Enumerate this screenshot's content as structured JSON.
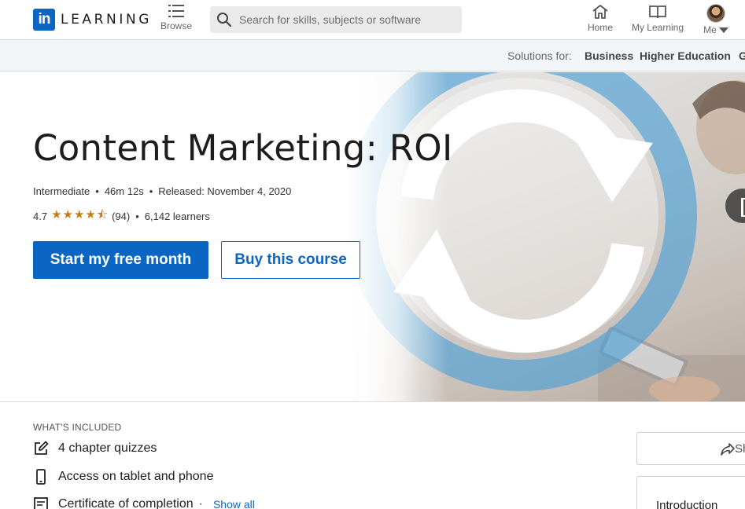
{
  "brand": {
    "logo_mark": "in",
    "wordmark": "LEARNING",
    "color": "#0a66c2"
  },
  "topnav": {
    "browse_label": "Browse",
    "search_placeholder": "Search for skills, subjects or software",
    "home_label": "Home",
    "mylearning_label": "My Learning",
    "me_label": "Me"
  },
  "solutions": {
    "label": "Solutions for:",
    "items": [
      "Business",
      "Higher Education",
      "G"
    ]
  },
  "course": {
    "title": "Content Marketing: ROI",
    "level": "Intermediate",
    "duration": "46m 12s",
    "released": "Released: November 4, 2020",
    "rating": "4.7",
    "rating_value": 4.7,
    "stars": "★★★★⯪",
    "review_count": "(94)",
    "learners": "6,142 learners"
  },
  "actions": {
    "primary": "Start my free month",
    "secondary": "Buy this course"
  },
  "included": {
    "title": "WHAT'S INCLUDED",
    "items": [
      "4 chapter quizzes",
      "Access on tablet and phone",
      "Certificate of completion"
    ],
    "show_all": "Show all"
  },
  "sidebar": {
    "share_label": "Sh",
    "toc_first": "Introduction"
  },
  "icons": [
    "search-icon",
    "browse-icon",
    "home-icon",
    "book-icon",
    "avatar",
    "edit-icon",
    "phone-icon",
    "certificate-icon",
    "share-icon",
    "play-icon"
  ],
  "colors": {
    "accent": "#0a66c2",
    "star": "#c37d16",
    "hero_arrows": "#4d9fd6"
  }
}
